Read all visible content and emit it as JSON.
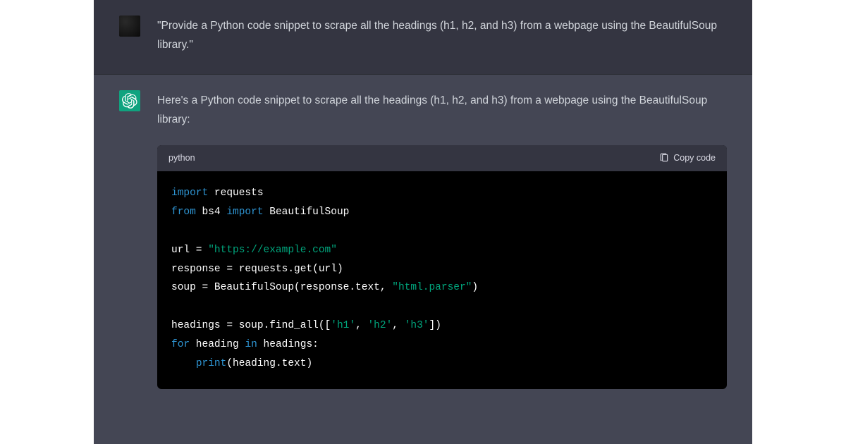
{
  "user": {
    "message": "\"Provide a Python code snippet to scrape all the headings (h1, h2, and h3) from a webpage using the BeautifulSoup library.\""
  },
  "assistant": {
    "message": "Here's a Python code snippet to scrape all the headings (h1, h2, and h3) from a webpage using the BeautifulSoup library:"
  },
  "code": {
    "language_label": "python",
    "copy_label": "Copy code",
    "tokens": [
      {
        "type": "kw",
        "text": "import"
      },
      {
        "type": "plain",
        "text": " requests\n"
      },
      {
        "type": "kw",
        "text": "from"
      },
      {
        "type": "plain",
        "text": " bs4 "
      },
      {
        "type": "kw",
        "text": "import"
      },
      {
        "type": "plain",
        "text": " BeautifulSoup\n"
      },
      {
        "type": "plain",
        "text": "\n"
      },
      {
        "type": "plain",
        "text": "url = "
      },
      {
        "type": "str",
        "text": "\"https://example.com\""
      },
      {
        "type": "plain",
        "text": "\n"
      },
      {
        "type": "plain",
        "text": "response = requests.get(url)\n"
      },
      {
        "type": "plain",
        "text": "soup = BeautifulSoup(response.text, "
      },
      {
        "type": "str",
        "text": "\"html.parser\""
      },
      {
        "type": "plain",
        "text": ")\n"
      },
      {
        "type": "plain",
        "text": "\n"
      },
      {
        "type": "plain",
        "text": "headings = soup.find_all(["
      },
      {
        "type": "str",
        "text": "'h1'"
      },
      {
        "type": "plain",
        "text": ", "
      },
      {
        "type": "str",
        "text": "'h2'"
      },
      {
        "type": "plain",
        "text": ", "
      },
      {
        "type": "str",
        "text": "'h3'"
      },
      {
        "type": "plain",
        "text": "])\n"
      },
      {
        "type": "kw",
        "text": "for"
      },
      {
        "type": "plain",
        "text": " heading "
      },
      {
        "type": "kw",
        "text": "in"
      },
      {
        "type": "plain",
        "text": " headings:\n"
      },
      {
        "type": "plain",
        "text": "    "
      },
      {
        "type": "kw",
        "text": "print"
      },
      {
        "type": "plain",
        "text": "(heading.text)"
      }
    ]
  }
}
